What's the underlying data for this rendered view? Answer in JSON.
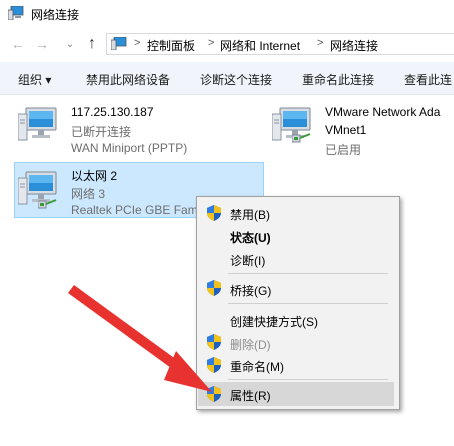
{
  "window": {
    "title": "网络连接"
  },
  "address": {
    "crumbs": [
      "控制面板",
      "网络和 Internet",
      "网络连接"
    ],
    "separator": ">"
  },
  "nav": {
    "back": "←",
    "forward": "→",
    "recent": "⌄",
    "up": "↑"
  },
  "toolbar": {
    "organize": "组织 ▾",
    "disable": "禁用此网络设备",
    "diagnose": "诊断这个连接",
    "rename": "重命名此连接",
    "view_status": "查看此连"
  },
  "connections": [
    {
      "name": "117.25.130.187",
      "status": "已断开连接",
      "device": "WAN Miniport (PPTP)"
    },
    {
      "name": "VMware Network Ada",
      "status": "VMnet1",
      "device": "已启用"
    },
    {
      "name": "以太网 2",
      "status": "网络 3",
      "device": "Realtek PCIe GBE Fam"
    }
  ],
  "context_menu": {
    "items": [
      {
        "label": "禁用(B)",
        "shield": true,
        "bold": false,
        "disabled": false
      },
      {
        "label": "状态(U)",
        "shield": false,
        "bold": true,
        "disabled": false
      },
      {
        "label": "诊断(I)",
        "shield": false,
        "bold": false,
        "disabled": false
      },
      {
        "label": "桥接(G)",
        "shield": true,
        "bold": false,
        "disabled": false
      },
      {
        "label": "创建快捷方式(S)",
        "shield": false,
        "bold": false,
        "disabled": false
      },
      {
        "label": "删除(D)",
        "shield": true,
        "bold": false,
        "disabled": true
      },
      {
        "label": "重命名(M)",
        "shield": true,
        "bold": false,
        "disabled": false
      },
      {
        "label": "属性(R)",
        "shield": true,
        "bold": false,
        "disabled": false
      }
    ],
    "highlighted": "属性(R)"
  },
  "colors": {
    "selection_bg": "#cce8ff",
    "annotation_arrow": "#e8322f",
    "toolbar_bg": "#f1f5fb"
  }
}
